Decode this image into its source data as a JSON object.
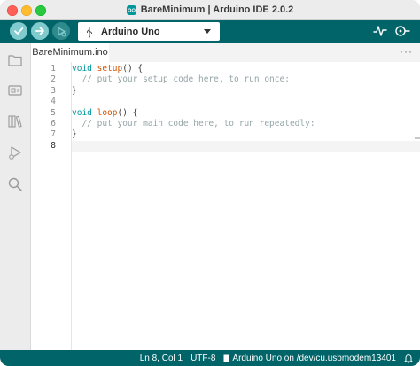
{
  "window": {
    "title": "BareMinimum | Arduino IDE 2.0.2"
  },
  "toolbar": {
    "board_label": "Arduino Uno",
    "icons": {
      "verify": "check-icon",
      "upload": "arrow-right-icon",
      "debug": "debug-icon",
      "board_usb": "usb-icon",
      "dropdown": "chevron-down-icon",
      "serial_plotter": "serial-plotter-icon",
      "serial_monitor": "serial-monitor-icon"
    }
  },
  "activitybar": {
    "icons": [
      "folder-icon",
      "board-manager-icon",
      "library-icon",
      "debug-run-icon",
      "search-icon"
    ]
  },
  "tabs": [
    {
      "label": "BareMinimum.ino"
    }
  ],
  "editor": {
    "cursor_line": 8,
    "lines": [
      {
        "num": "1",
        "tokens": [
          {
            "t": "void ",
            "k": "kw"
          },
          {
            "t": "setup",
            "k": "fn"
          },
          {
            "t": "() {",
            "k": "pl"
          }
        ]
      },
      {
        "num": "2",
        "tokens": [
          {
            "t": "  // put your setup code here, to run once:",
            "k": "cm"
          }
        ]
      },
      {
        "num": "3",
        "tokens": [
          {
            "t": "}",
            "k": "pl"
          }
        ]
      },
      {
        "num": "4",
        "tokens": []
      },
      {
        "num": "5",
        "tokens": [
          {
            "t": "void ",
            "k": "kw"
          },
          {
            "t": "loop",
            "k": "fn"
          },
          {
            "t": "() {",
            "k": "pl"
          }
        ]
      },
      {
        "num": "6",
        "tokens": [
          {
            "t": "  // put your main code here, to run repeatedly:",
            "k": "cm"
          }
        ]
      },
      {
        "num": "7",
        "tokens": [
          {
            "t": "}",
            "k": "pl"
          }
        ]
      },
      {
        "num": "8",
        "tokens": []
      }
    ]
  },
  "statusbar": {
    "position": "Ln 8, Col 1",
    "encoding": "UTF-8",
    "board_port": "Arduino Uno on /dev/cu.usbmodem13401",
    "notification_icon": "bell-icon"
  },
  "colors": {
    "toolbar_bg": "#006468",
    "button_bg": "#7fcbcd",
    "keyword": "#00979d",
    "function": "#d35400",
    "comment": "#95a5a6"
  }
}
